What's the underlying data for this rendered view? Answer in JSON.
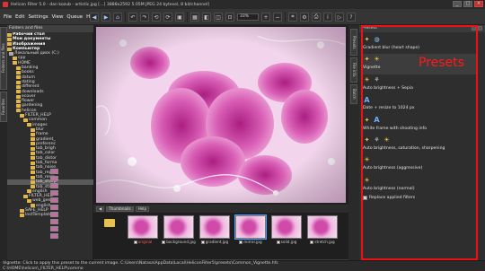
{
  "window": {
    "title": "Helicon Filter 5.0 - dan kozub - artistic.jpg […] 3888x2592 5.05M JPEG 24 bytesel, 8 bit/channel]"
  },
  "menu": [
    "File",
    "Edit",
    "Settings",
    "View",
    "Queue",
    "Help"
  ],
  "toolbar": {
    "zoom": "33%"
  },
  "sidebar": {
    "header": "Folders and files",
    "tabs": [
      "Folders and files",
      "Favorites"
    ],
    "tree": [
      {
        "label": "Рабочий стол",
        "bold": true
      },
      {
        "label": "Мои документы",
        "bold": true
      },
      {
        "label": "Изображения",
        "bold": true
      },
      {
        "label": "Компьютер",
        "bold": true
      },
      {
        "label": "Локальный диск (C:)",
        "drive": true
      },
      {
        "label": "cpp"
      },
      {
        "label": "HOME"
      },
      {
        "label": "banking"
      },
      {
        "label": "books"
      },
      {
        "label": "datum"
      },
      {
        "label": "dating"
      },
      {
        "label": "different"
      },
      {
        "label": "downloads"
      },
      {
        "label": "ecover"
      },
      {
        "label": "flower"
      },
      {
        "label": "gardening"
      },
      {
        "label": "helicon"
      },
      {
        "label": "FILTER_HELP"
      },
      {
        "label": "common"
      },
      {
        "label": "images"
      },
      {
        "label": "blur"
      },
      {
        "label": "frame"
      },
      {
        "label": "gradient_"
      },
      {
        "label": "preferenc"
      },
      {
        "label": "tab_brigh"
      },
      {
        "label": "tab_color"
      },
      {
        "label": "tab_distor"
      },
      {
        "label": "tab_forma"
      },
      {
        "label": "tab_noise"
      },
      {
        "label": "tab_repo"
      },
      {
        "label": "tab_resiz"
      },
      {
        "label": "tab_sharp"
      },
      {
        "label": "tab_stati"
      },
      {
        "label": "english"
      },
      {
        "label": "FILTER_HELP"
      },
      {
        "label": "web_gen"
      },
      {
        "label": "english"
      },
      {
        "label": "SAFE_HELP"
      },
      {
        "label": "InstTemplates"
      }
    ]
  },
  "strip": {
    "tabs": [
      "Thumbnails",
      "Help"
    ],
    "items": [
      {
        "label": "original",
        "red": true
      },
      {
        "label": "background.jpg",
        "red": false
      },
      {
        "label": "gradient.jpg",
        "red": false
      },
      {
        "label": "mirror.jpg",
        "red": false
      },
      {
        "label": "solid.jpg",
        "red": false
      },
      {
        "label": "stretch.jpg",
        "red": false
      }
    ]
  },
  "right_tabs": [
    "Presets",
    "File info",
    "Batch"
  ],
  "presets": {
    "header": "Presets",
    "annotation": "Presets",
    "items": [
      {
        "label": "Gradient blur (heart shape)",
        "icons": [
          "wand",
          "globe"
        ]
      },
      {
        "label": "Vignette",
        "icons": [
          "wand",
          "sun"
        ]
      },
      {
        "label": "Auto brightness + Sepia",
        "icons": [
          "sun",
          "sk"
        ]
      },
      {
        "label": "Date + resize to 1024 px",
        "icons": [
          "a"
        ]
      },
      {
        "label": "White frame with shooting info",
        "icons": [
          "wand",
          "a"
        ]
      },
      {
        "label": "Auto brightness, saturation, sharpening",
        "icons": [
          "wand",
          "sk",
          "sun"
        ]
      },
      {
        "label": "Auto brightness (aggressive)",
        "icons": [
          "sun"
        ]
      },
      {
        "label": "Auto brightness (normal)",
        "icons": [
          "sun"
        ]
      }
    ],
    "replace_label": "Replace applied filters"
  },
  "status": {
    "line1": "Vignette: Click to apply this preset to the current image.  C:\\Users\\Natasa\\AppData\\Local\\HeliconFilter5\\presets\\Common_Vignette.hfs",
    "line2": "C:\\HOME\\helicon\\_FILTER_HELP\\commo"
  }
}
